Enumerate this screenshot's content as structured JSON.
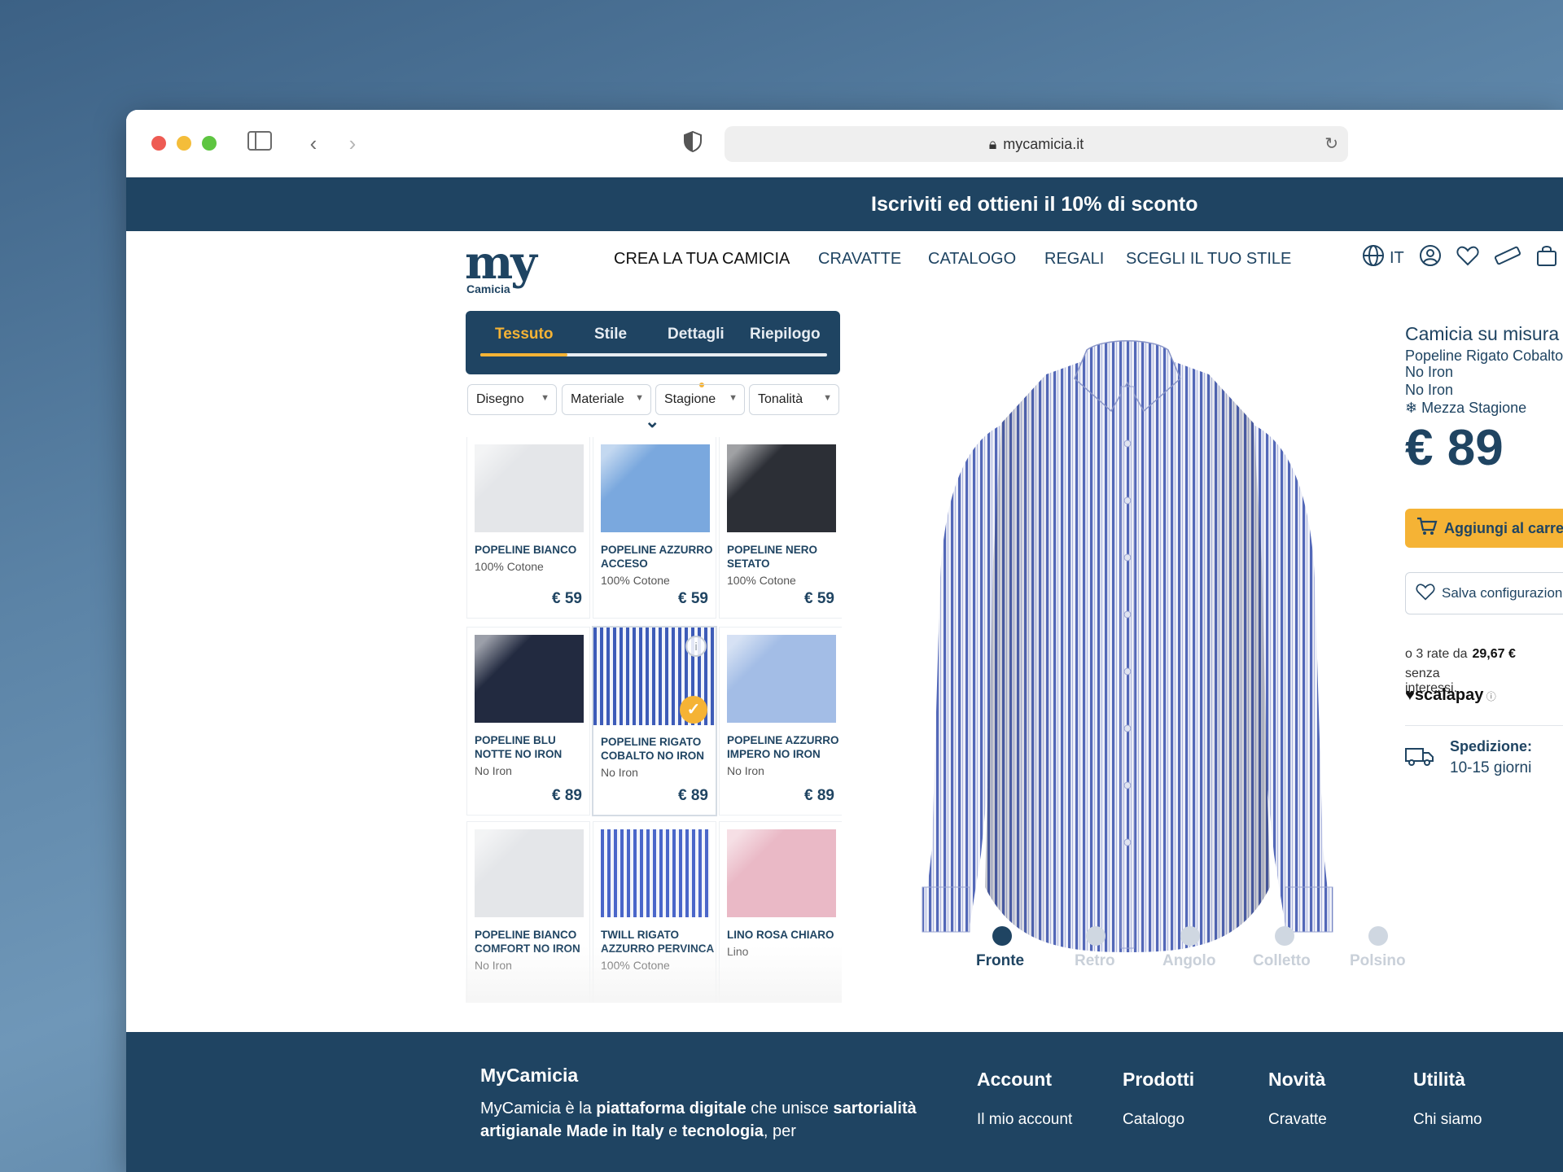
{
  "browser": {
    "url": "mycamicia.it"
  },
  "promo": {
    "text": "Iscriviti ed ottieni il 10% di sconto"
  },
  "logo": {
    "main": "my",
    "sub": "Camicia"
  },
  "nav": {
    "items": [
      "CREA LA TUA CAMICIA",
      "CRAVATTE",
      "CATALOGO",
      "REGALI",
      "SCEGLI IL TUO STILE"
    ],
    "active_index": 0,
    "language": "IT"
  },
  "tabs": {
    "items": [
      "Tessuto",
      "Stile",
      "Dettagli",
      "Riepilogo"
    ],
    "active_index": 0,
    "progress": 0.25
  },
  "filters": [
    "Disegno",
    "Materiale",
    "Stagione",
    "Tonalità"
  ],
  "fabrics": [
    {
      "name": "POPELINE BIANCO",
      "material": "100% Cotone",
      "price": "€ 59",
      "color": "#e4e6e9",
      "pattern": "plain"
    },
    {
      "name": "POPELINE AZZURRO ACCESO",
      "material": "100% Cotone",
      "price": "€ 59",
      "color": "#7aa8de",
      "pattern": "plain"
    },
    {
      "name": "POPELINE NERO SETATO",
      "material": "100% Cotone",
      "price": "€ 59",
      "color": "#2c2f36",
      "pattern": "plain"
    },
    {
      "name": "POPELINE BLU NOTTE NO IRON",
      "material": "No Iron",
      "price": "€ 89",
      "color": "#222a40",
      "pattern": "plain"
    },
    {
      "name": "POPELINE RIGATO COBALTO NO IRON",
      "material": "No Iron",
      "price": "€ 89",
      "color": "#3d5bb8",
      "pattern": "stripe",
      "selected": true
    },
    {
      "name": "POPELINE AZZURRO IMPERO NO IRON",
      "material": "No Iron",
      "price": "€ 89",
      "color": "#a3bde6",
      "pattern": "plain"
    },
    {
      "name": "POPELINE BIANCO COMFORT NO IRON",
      "material": "No Iron",
      "price": "",
      "color": "#e4e6e9",
      "pattern": "plain"
    },
    {
      "name": "TWILL RIGATO AZZURRO PERVINCA",
      "material": "100% Cotone",
      "price": "",
      "color": "#4a66c9",
      "pattern": "stripe"
    },
    {
      "name": "LINO ROSA CHIARO",
      "material": "Lino",
      "price": "",
      "color": "#eab9c6",
      "pattern": "plain"
    }
  ],
  "views": {
    "items": [
      "Fronte",
      "Retro",
      "Angolo",
      "Colletto",
      "Polsino"
    ],
    "active_index": 0
  },
  "product": {
    "title": "Camicia su misura",
    "fabric": "Popeline Rigato Cobalto",
    "line1": "No Iron",
    "line2": "No Iron",
    "season": "Mezza Stagione",
    "price": "€ 89",
    "add_to_cart": "Aggiungi al carrello",
    "save": "Salva configurazione",
    "installments_prefix": "o 3 rate da",
    "installments_value": "29,67 €",
    "installments_suffix": "senza interessi.",
    "scalapay": "scalapay",
    "shipping_label": "Spedizione:",
    "shipping_value": "10-15 giorni"
  },
  "footer": {
    "brand": "MyCamicia",
    "text_a": "MyCamicia è la ",
    "text_b": "piattaforma digitale",
    "text_c": " che unisce ",
    "text_d": "sartorialità artigianale Made in Italy",
    "text_e": " e ",
    "text_f": "tecnologia",
    "text_g": ", per",
    "columns": [
      {
        "title": "Account",
        "link": "Il mio account"
      },
      {
        "title": "Prodotti",
        "link": "Catalogo"
      },
      {
        "title": "Novità",
        "link": "Cravatte"
      },
      {
        "title": "Utilità",
        "link": "Chi siamo"
      }
    ]
  }
}
